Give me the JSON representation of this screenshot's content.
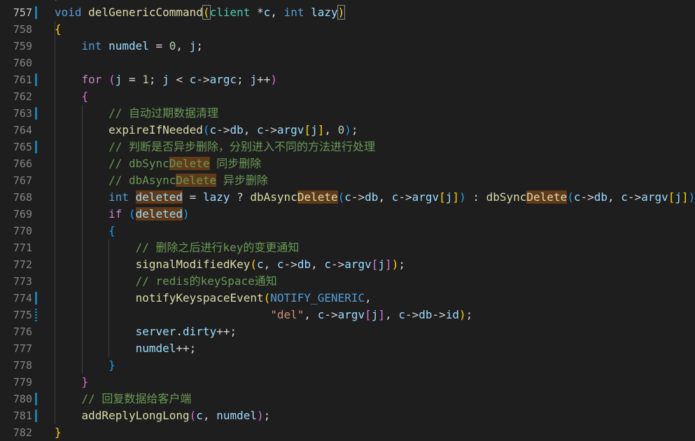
{
  "editor": {
    "top_partial_text": "/",
    "lines": [
      {
        "n": "757",
        "current": true,
        "tokens": [
          [
            "kw",
            "void"
          ],
          [
            "plain",
            " "
          ],
          [
            "fn",
            "delGenericCommand"
          ],
          [
            "b1bm",
            "("
          ],
          [
            "type",
            "client"
          ],
          [
            "plain",
            " "
          ],
          [
            "plain",
            "*"
          ],
          [
            "var",
            "c"
          ],
          [
            "plain",
            ", "
          ],
          [
            "kw",
            "int"
          ],
          [
            "plain",
            " "
          ],
          [
            "var",
            "lazy"
          ],
          [
            "b1bm",
            ")"
          ]
        ]
      },
      {
        "n": "758",
        "tokens": [
          [
            "b1",
            "{"
          ]
        ]
      },
      {
        "n": "759",
        "tokens": [
          [
            "plain",
            "    "
          ],
          [
            "kw",
            "int"
          ],
          [
            "plain",
            " "
          ],
          [
            "var",
            "numdel"
          ],
          [
            "plain",
            " = "
          ],
          [
            "num",
            "0"
          ],
          [
            "plain",
            ", "
          ],
          [
            "var",
            "j"
          ],
          [
            "plain",
            ";"
          ]
        ]
      },
      {
        "n": "760",
        "tokens": []
      },
      {
        "n": "761",
        "tokens": [
          [
            "plain",
            "    "
          ],
          [
            "ctl",
            "for"
          ],
          [
            "plain",
            " "
          ],
          [
            "b2",
            "("
          ],
          [
            "var",
            "j"
          ],
          [
            "plain",
            " = "
          ],
          [
            "num",
            "1"
          ],
          [
            "plain",
            "; "
          ],
          [
            "var",
            "j"
          ],
          [
            "plain",
            " < "
          ],
          [
            "var",
            "c"
          ],
          [
            "plain",
            "->"
          ],
          [
            "var",
            "argc"
          ],
          [
            "plain",
            "; "
          ],
          [
            "var",
            "j"
          ],
          [
            "plain",
            "++"
          ],
          [
            "b2",
            ")"
          ]
        ]
      },
      {
        "n": "762",
        "tokens": [
          [
            "plain",
            "    "
          ],
          [
            "b2",
            "{"
          ]
        ]
      },
      {
        "n": "763",
        "tokens": [
          [
            "plain",
            "        "
          ],
          [
            "cm",
            "// 自动过期数据清理"
          ]
        ]
      },
      {
        "n": "764",
        "tokens": [
          [
            "plain",
            "        "
          ],
          [
            "fn",
            "expireIfNeeded"
          ],
          [
            "b3",
            "("
          ],
          [
            "var",
            "c"
          ],
          [
            "plain",
            "->"
          ],
          [
            "var",
            "db"
          ],
          [
            "plain",
            ", "
          ],
          [
            "var",
            "c"
          ],
          [
            "plain",
            "->"
          ],
          [
            "var",
            "argv"
          ],
          [
            "b1",
            "["
          ],
          [
            "var",
            "j"
          ],
          [
            "b1",
            "]"
          ],
          [
            "plain",
            ", "
          ],
          [
            "num",
            "0"
          ],
          [
            "b3",
            ")"
          ],
          [
            "plain",
            ";"
          ]
        ]
      },
      {
        "n": "765",
        "tokens": [
          [
            "plain",
            "        "
          ],
          [
            "cm",
            "// 判断是否异步删除，分别进入不同的方法进行处理"
          ]
        ]
      },
      {
        "n": "766",
        "tokens": [
          [
            "plain",
            "        "
          ],
          [
            "cm",
            "// dbSync"
          ],
          [
            "cmhl",
            "Delete"
          ],
          [
            "cm",
            " 同步删除"
          ]
        ]
      },
      {
        "n": "767",
        "tokens": [
          [
            "plain",
            "        "
          ],
          [
            "cm",
            "// dbAsync"
          ],
          [
            "cmhl",
            "Delete"
          ],
          [
            "cm",
            " 异步删除"
          ]
        ]
      },
      {
        "n": "768",
        "tokens": [
          [
            "plain",
            "        "
          ],
          [
            "kw",
            "int"
          ],
          [
            "plain",
            " "
          ],
          [
            "varhl",
            "deleted"
          ],
          [
            "plain",
            " = "
          ],
          [
            "var",
            "lazy"
          ],
          [
            "plain",
            " ? "
          ],
          [
            "fn",
            "dbAsync"
          ],
          [
            "fnhl",
            "Delete"
          ],
          [
            "b3",
            "("
          ],
          [
            "var",
            "c"
          ],
          [
            "plain",
            "->"
          ],
          [
            "var",
            "db"
          ],
          [
            "plain",
            ", "
          ],
          [
            "var",
            "c"
          ],
          [
            "plain",
            "->"
          ],
          [
            "var",
            "argv"
          ],
          [
            "b1",
            "["
          ],
          [
            "var",
            "j"
          ],
          [
            "b1",
            "]"
          ],
          [
            "b3",
            ")"
          ],
          [
            "plain",
            " : "
          ],
          [
            "fn",
            "dbSync"
          ],
          [
            "fnhl",
            "Delete"
          ],
          [
            "b3",
            "("
          ],
          [
            "var",
            "c"
          ],
          [
            "plain",
            "->"
          ],
          [
            "var",
            "db"
          ],
          [
            "plain",
            ", "
          ],
          [
            "var",
            "c"
          ],
          [
            "plain",
            "->"
          ],
          [
            "var",
            "argv"
          ],
          [
            "b1",
            "["
          ],
          [
            "var",
            "j"
          ],
          [
            "b1",
            "]"
          ],
          [
            "b3",
            ")"
          ],
          [
            "plain",
            ";"
          ]
        ]
      },
      {
        "n": "769",
        "tokens": [
          [
            "plain",
            "        "
          ],
          [
            "ctl",
            "if"
          ],
          [
            "plain",
            " "
          ],
          [
            "b3",
            "("
          ],
          [
            "varhl",
            "deleted"
          ],
          [
            "b3",
            ")"
          ]
        ]
      },
      {
        "n": "770",
        "tokens": [
          [
            "plain",
            "        "
          ],
          [
            "b3",
            "{"
          ]
        ]
      },
      {
        "n": "771",
        "tokens": [
          [
            "plain",
            "            "
          ],
          [
            "cm",
            "// 删除之后进行key的变更通知"
          ]
        ]
      },
      {
        "n": "772",
        "tokens": [
          [
            "plain",
            "            "
          ],
          [
            "fn",
            "signalModifiedKey"
          ],
          [
            "b1",
            "("
          ],
          [
            "var",
            "c"
          ],
          [
            "plain",
            ", "
          ],
          [
            "var",
            "c"
          ],
          [
            "plain",
            "->"
          ],
          [
            "var",
            "db"
          ],
          [
            "plain",
            ", "
          ],
          [
            "var",
            "c"
          ],
          [
            "plain",
            "->"
          ],
          [
            "var",
            "argv"
          ],
          [
            "b2",
            "["
          ],
          [
            "var",
            "j"
          ],
          [
            "b2",
            "]"
          ],
          [
            "b1",
            ")"
          ],
          [
            "plain",
            ";"
          ]
        ]
      },
      {
        "n": "773",
        "tokens": [
          [
            "plain",
            "            "
          ],
          [
            "cm",
            "// redis的keySpace通知"
          ]
        ]
      },
      {
        "n": "774",
        "tokens": [
          [
            "plain",
            "            "
          ],
          [
            "fn",
            "notifyKeyspaceEvent"
          ],
          [
            "b1",
            "("
          ],
          [
            "macro",
            "NOTIFY_GENERIC"
          ],
          [
            "plain",
            ","
          ]
        ]
      },
      {
        "n": "775",
        "tokens": [
          [
            "plain",
            "                                "
          ],
          [
            "str",
            "\"del\""
          ],
          [
            "plain",
            ", "
          ],
          [
            "var",
            "c"
          ],
          [
            "plain",
            "->"
          ],
          [
            "var",
            "argv"
          ],
          [
            "b2",
            "["
          ],
          [
            "var",
            "j"
          ],
          [
            "b2",
            "]"
          ],
          [
            "plain",
            ", "
          ],
          [
            "var",
            "c"
          ],
          [
            "plain",
            "->"
          ],
          [
            "var",
            "db"
          ],
          [
            "plain",
            "->"
          ],
          [
            "var",
            "id"
          ],
          [
            "b1",
            ")"
          ],
          [
            "plain",
            ";"
          ]
        ]
      },
      {
        "n": "776",
        "tokens": [
          [
            "plain",
            "            "
          ],
          [
            "var",
            "server"
          ],
          [
            "plain",
            "."
          ],
          [
            "var",
            "dirty"
          ],
          [
            "plain",
            "++;"
          ]
        ]
      },
      {
        "n": "777",
        "tokens": [
          [
            "plain",
            "            "
          ],
          [
            "var",
            "numdel"
          ],
          [
            "plain",
            "++;"
          ]
        ]
      },
      {
        "n": "778",
        "tokens": [
          [
            "plain",
            "        "
          ],
          [
            "b3",
            "}"
          ]
        ]
      },
      {
        "n": "779",
        "tokens": [
          [
            "plain",
            "    "
          ],
          [
            "b2",
            "}"
          ]
        ]
      },
      {
        "n": "780",
        "tokens": [
          [
            "plain",
            "    "
          ],
          [
            "cm",
            "// 回复数据给客户端"
          ]
        ]
      },
      {
        "n": "781",
        "tokens": [
          [
            "plain",
            "    "
          ],
          [
            "fn",
            "addReplyLongLong"
          ],
          [
            "b2",
            "("
          ],
          [
            "var",
            "c"
          ],
          [
            "plain",
            ", "
          ],
          [
            "var",
            "numdel"
          ],
          [
            "b2",
            ")"
          ],
          [
            "plain",
            ";"
          ]
        ]
      },
      {
        "n": "782",
        "tokens": [
          [
            "b1",
            "}"
          ]
        ]
      }
    ],
    "modified_lines": [
      "757",
      "761",
      "763",
      "765",
      "774",
      "775",
      "780",
      "781"
    ],
    "hatched_lines": [
      "775"
    ]
  },
  "colors": {
    "background": "#1e1e1e",
    "line_number": "#858585",
    "keyword": "#569cd6",
    "control": "#c586c0",
    "function": "#dcdcaa",
    "variable": "#9cdcfe",
    "type": "#4ec9b0",
    "number": "#b5cea8",
    "string": "#ce9178",
    "comment": "#6a9955",
    "find_highlight": "#613a18",
    "git_modified": "#1b81a8"
  }
}
